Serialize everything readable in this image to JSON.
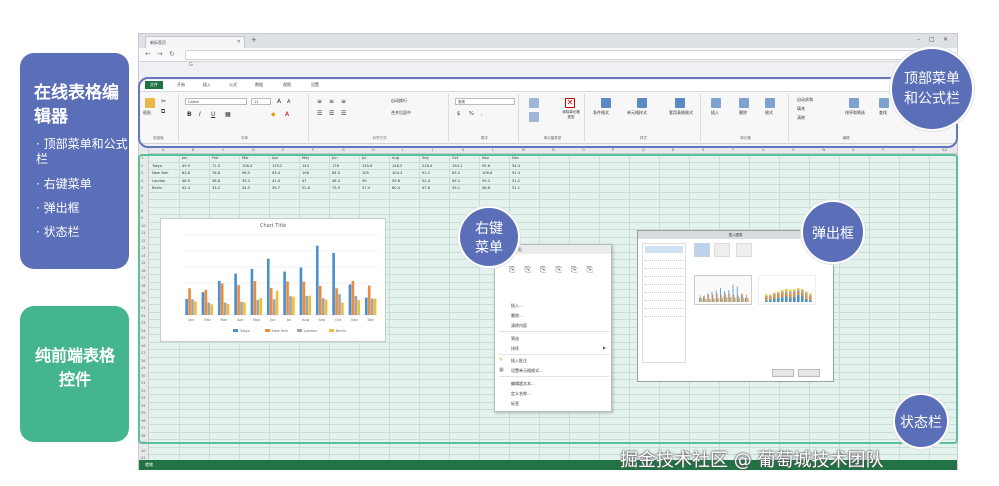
{
  "left_panel": {
    "title": "在线表格编辑器",
    "items": [
      "· 顶部菜单和公式栏",
      "· 右键菜单",
      "· 弹出框",
      "· 状态栏"
    ]
  },
  "green_panel": {
    "text": "纯前端表格控件"
  },
  "bubbles": {
    "top_menu": "顶部菜单和公式栏",
    "context_menu": "右键菜单",
    "dialog": "弹出框",
    "status_bar": "状态栏"
  },
  "browser": {
    "tab_title": "新标签页",
    "url": "G"
  },
  "ribbon": {
    "tabs": [
      "文件",
      "开始",
      "插入",
      "公式",
      "数据",
      "视图",
      "设置"
    ],
    "active_tab": "文件",
    "font_name": "Calibri",
    "font_size": "11",
    "number_format": "常规",
    "groups": [
      "剪贴板",
      "字体",
      "对齐方式",
      "数字",
      "单元格类型",
      "样式",
      "单元格",
      "编辑"
    ],
    "buttons": {
      "paste": "粘贴",
      "wrap": "自动换行",
      "merge": "合并后居中",
      "celltype_remove": "清除单元格类型",
      "cond_format": "条件格式",
      "cell_style": "单元格样式",
      "table_format": "套用表格格式",
      "insert": "插入",
      "delete": "删除",
      "format": "格式",
      "autosum": "自动求和",
      "fill": "填充",
      "clear": "清除",
      "sort_filter": "排序和筛选",
      "find": "查找"
    }
  },
  "sheet": {
    "columns": [
      "A",
      "B",
      "C",
      "D",
      "E",
      "F",
      "G",
      "H",
      "I",
      "J",
      "K",
      "L",
      "M",
      "N",
      "O",
      "P",
      "Q",
      "R",
      "S",
      "T",
      "U",
      "V",
      "W",
      "X",
      "Y",
      "Z",
      "AA"
    ],
    "months": [
      "Jan",
      "Feb",
      "Mar",
      "Apr",
      "May",
      "Jun",
      "Jul",
      "Aug",
      "Sep",
      "Oct",
      "Nov",
      "Dec"
    ],
    "rows": [
      {
        "city": "Tokyo",
        "values": [
          "49.9",
          "71.5",
          "106.4",
          "129.2",
          "144",
          "176",
          "135.6",
          "148.5",
          "216.4",
          "194.1",
          "95.6",
          "54.4"
        ]
      },
      {
        "city": "New York",
        "values": [
          "83.6",
          "78.8",
          "98.5",
          "93.4",
          "106",
          "84.5",
          "105",
          "104.3",
          "91.2",
          "83.5",
          "106.6",
          "92.3"
        ]
      },
      {
        "city": "London",
        "values": [
          "48.9",
          "38.8",
          "39.3",
          "41.4",
          "47",
          "48.3",
          "59",
          "59.6",
          "52.4",
          "65.2",
          "59.3",
          "51.2"
        ]
      },
      {
        "city": "Berlin",
        "values": [
          "42.4",
          "33.2",
          "34.5",
          "39.7",
          "52.6",
          "75.5",
          "57.4",
          "60.4",
          "47.6",
          "39.1",
          "46.8",
          "51.1"
        ]
      }
    ]
  },
  "chart_data": {
    "type": "bar",
    "title": "Chart Title",
    "categories": [
      "Jan",
      "Feb",
      "Mar",
      "Apr",
      "May",
      "Jun",
      "Jul",
      "Aug",
      "Sep",
      "Oct",
      "Nov",
      "Dec"
    ],
    "series": [
      {
        "name": "Tokyo",
        "values": [
          49.9,
          71.5,
          106.4,
          129.2,
          144,
          176,
          135.6,
          148.5,
          216.4,
          194.1,
          95.6,
          54.4
        ]
      },
      {
        "name": "New York",
        "values": [
          83.6,
          78.8,
          98.5,
          93.4,
          106,
          84.5,
          105,
          104.3,
          91.2,
          83.5,
          106.6,
          92.3
        ]
      },
      {
        "name": "London",
        "values": [
          48.9,
          38.8,
          39.3,
          41.4,
          47,
          48.3,
          59,
          59.6,
          52.4,
          65.2,
          59.3,
          51.2
        ]
      },
      {
        "name": "Berlin",
        "values": [
          42.4,
          33.2,
          34.5,
          39.7,
          52.6,
          75.5,
          57.4,
          60.4,
          47.6,
          39.1,
          46.8,
          51.1
        ]
      }
    ],
    "colors": [
      "#4e8fce",
      "#e98c3f",
      "#a3a3a3",
      "#f1be3b"
    ],
    "ylim": [
      0,
      250
    ],
    "legend": "bottom"
  },
  "context_menu": {
    "header": "粘贴选项:",
    "items": [
      "插入...",
      "删除...",
      "清除内容",
      "筛选",
      "排序",
      "插入批注",
      "设置单元格格式...",
      "编辑超文本...",
      "定义名称...",
      "标签"
    ]
  },
  "dialog": {
    "title": "插入图表"
  },
  "status": {
    "text": "就绪"
  },
  "watermark": "掘金技术社区 @ 葡萄城技术团队"
}
